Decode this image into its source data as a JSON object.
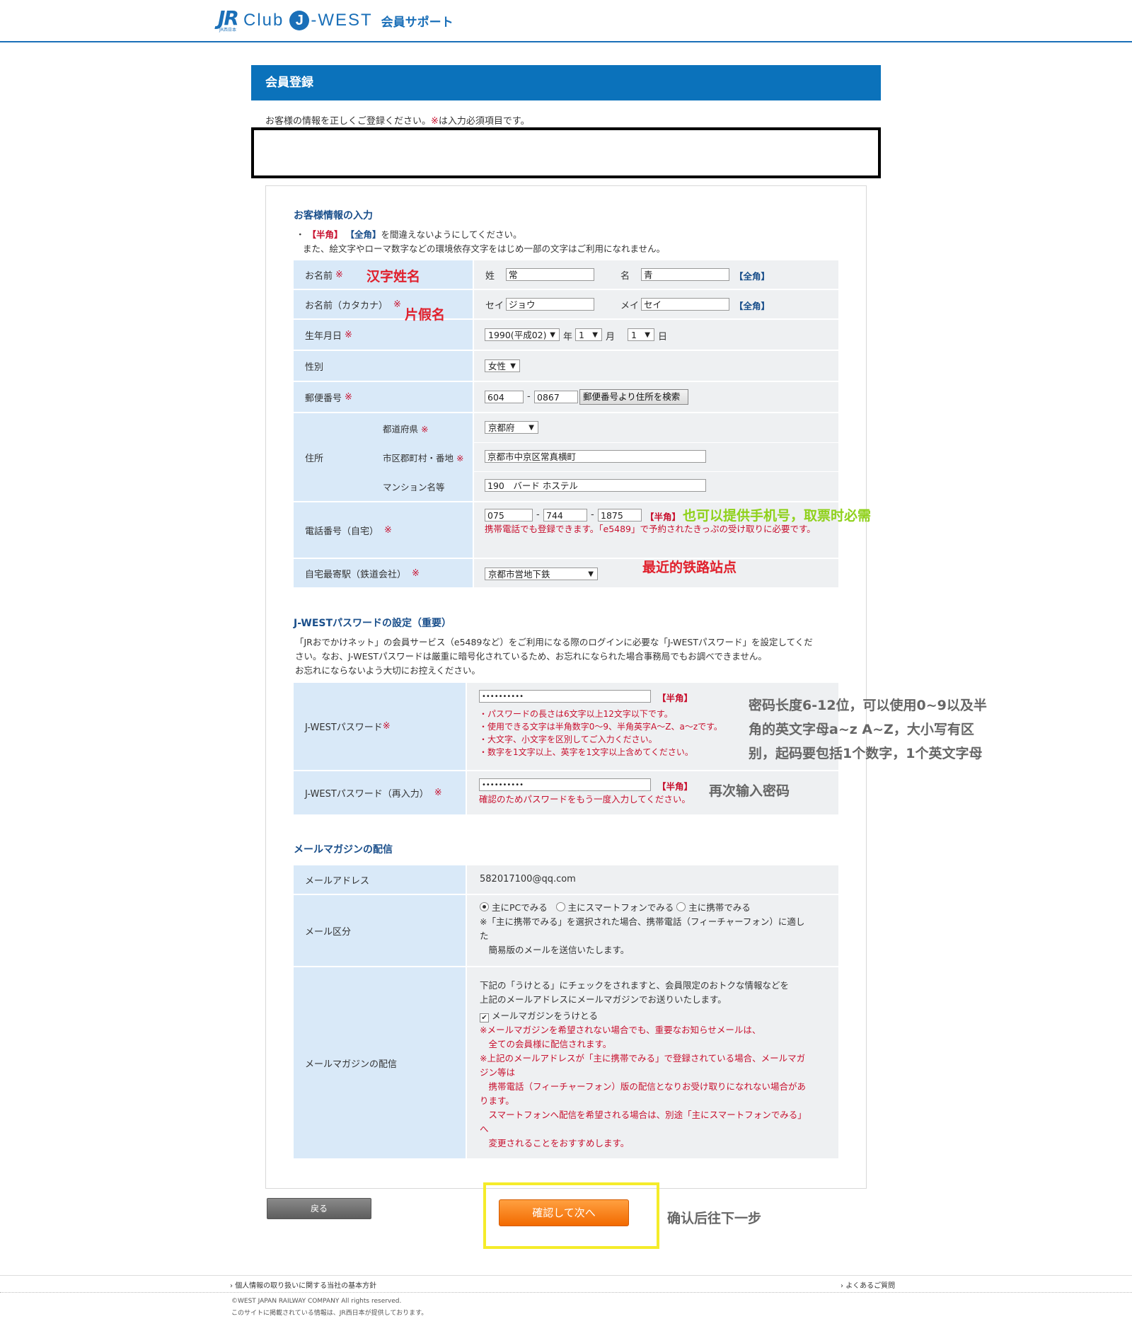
{
  "header": {
    "logo_jr": "JR",
    "logo_sub": "JR西日本",
    "logo_club": "Club",
    "logo_j": "J",
    "logo_west": "-WEST",
    "support": "会員サポート"
  },
  "title": "会員登録",
  "intro": {
    "before": "お客様の情報を正しくご登録ください。",
    "mark": "※",
    "after": "は入力必須項目です。"
  },
  "customer": {
    "section_title": "お客様情報の入力",
    "note_bullet": "・",
    "note_han": "【半角】",
    "note_zen": "【全角】",
    "note_line1_rest": "を間違えないようにしてください。",
    "note_line2": "また、絵文字やローマ数字などの環境依存文字をはじめ一部の文字はご利用になれません。",
    "req_mark": "※",
    "name": {
      "label": "お名前",
      "sei_label": "姓",
      "sei": "常",
      "mei_label": "名",
      "mei": "青",
      "tag": "【全角】",
      "annotation": "汉字姓名"
    },
    "kana": {
      "label": "お名前（カタカナ）",
      "sei_label": "セイ",
      "sei": "ジョウ",
      "mei_label": "メイ",
      "mei": "セイ",
      "tag": "【全角】",
      "annotation": "片假名"
    },
    "birth": {
      "label": "生年月日",
      "year": "1990(平成02)",
      "year_unit": "年",
      "month": "1",
      "month_unit": "月",
      "day": "1",
      "day_unit": "日"
    },
    "gender": {
      "label": "性別",
      "value": "女性"
    },
    "postal": {
      "label": "郵便番号",
      "first": "604",
      "dash": "-",
      "second": "0867",
      "button": "郵便番号より住所を検索"
    },
    "address": {
      "label": "住所",
      "pref_label": "都道府県",
      "pref": "京都府",
      "city_label": "市区郡町村・番地",
      "city": "京都市中京区常真横町",
      "building_label": "マンション名等",
      "building": "190　バード ホステル"
    },
    "phone": {
      "label": "電話番号（自宅）",
      "a": "075",
      "b": "744",
      "c": "1875",
      "dash": "-",
      "tag": "【半角】",
      "note": "携帯電話でも登録できます。「e5489」で予約されたきっぷの受け取りに必要です。",
      "annotation": "也可以提供手机号，取票时必需"
    },
    "station": {
      "label": "自宅最寄駅（鉄道会社）",
      "value": "京都市営地下鉄",
      "annotation": "最近的铁路站点"
    }
  },
  "password": {
    "section_title": "J-WESTパスワードの設定（重要）",
    "desc1": "「JRおでかけネット」の会員サービス（e5489など）をご利用になる際のログインに必要な「J-WESTパスワード」を設定してくだ",
    "desc2": "さい。なお、J-WESTパスワードは厳重に暗号化されているため、お忘れになられた場合事務局でもお調べできません。",
    "desc3": "お忘れにならないよう大切にお控えください。",
    "pw_label": "J-WESTパスワード",
    "pw_value": "••••••••••",
    "pw_tag": "【半角】",
    "rules": [
      "・パスワードの長さは6文字以上12文字以下です。",
      "・使用できる文字は半角数字0～9、半角英字A～Z、a～zです。",
      "・大文字、小文字を区別してご入力ください。",
      "・数字を1文字以上、英字を1文字以上含めてください。"
    ],
    "pw_annotation": [
      "密码长度6-12位，可以使用0~9以及半",
      "角的英文字母a~z A~Z，大小写有区",
      "别，起码要包括1个数字，1个英文字母"
    ],
    "confirm_label": "J-WESTパスワード（再入力）",
    "confirm_value": "••••••••••",
    "confirm_tag": "【半角】",
    "confirm_note": "確認のためパスワードをもう一度入力してください。",
    "confirm_annotation": "再次输入密码"
  },
  "mail": {
    "section_title": "メールマガジンの配信",
    "address_label": "メールアドレス",
    "address": "582017100@qq.com",
    "type_label": "メール区分",
    "options": [
      "主にPCでみる",
      "主にスマートフォンでみる",
      "主に携帯でみる"
    ],
    "type_note": [
      "※「主に携帯でみる」を選択された場合、携帯電話（フィーチャーフォン）に適し",
      "た",
      "　簡易版のメールを送信いたします。"
    ],
    "mag_label": "メールマガジンの配信",
    "mag_text": [
      "下記の「うけとる」にチェックをされますと、会員限定のおトクな情報などを",
      "上記のメールアドレスにメールマガジンでお送りいたします。"
    ],
    "mag_checkbox": "メールマガジンをうけとる",
    "mag_notes": [
      "※メールマガジンを希望されない場合でも、重要なお知らせメールは、",
      "　全ての会員様に配信されます。",
      "※上記のメールアドレスが「主に携帯でみる」で登録されている場合、メールマガ",
      "ジン等は",
      "　携帯電話（フィーチャーフォン）版の配信となりお受け取りになれない場合があ",
      "ります。",
      "　スマートフォンへ配信を希望される場合は、別途「主にスマートフォンでみる」",
      "へ",
      "　変更されることをおすすめします。"
    ]
  },
  "buttons": {
    "back": "戻る",
    "next": "確認して次へ",
    "next_annotation": "确认后往下一步"
  },
  "footer": {
    "privacy": "個人情報の取り扱いに関する当社の基本方針",
    "faq": "よくあるご質問",
    "copyright": "©WEST JAPAN RAILWAY COMPANY All rights reserved.",
    "notice": "このサイトに掲載されている情報は、JR西日本が提供しております。"
  }
}
